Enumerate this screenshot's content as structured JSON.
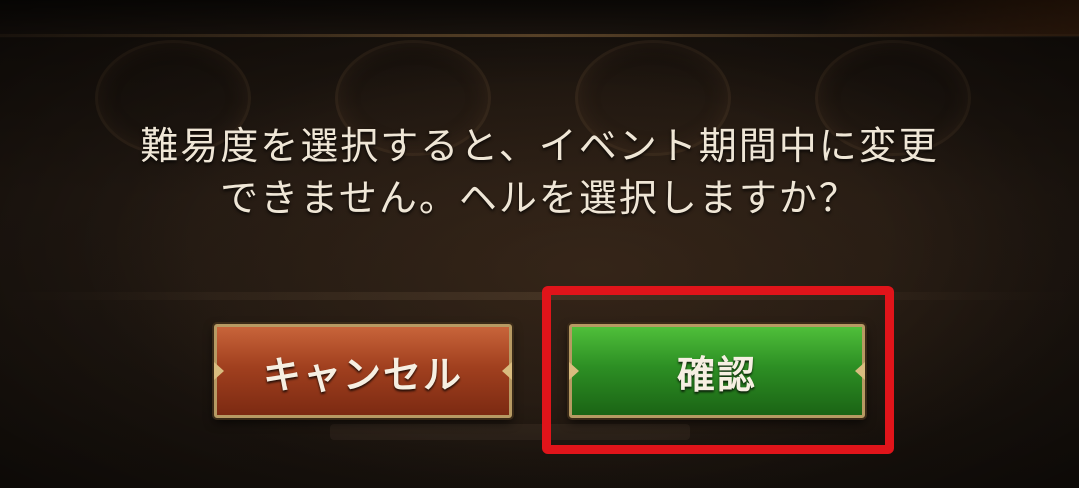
{
  "dialog": {
    "message_line1": "難易度を選択すると、イベント期間中に変更",
    "message_line2": "できません。ヘルを選択しますか？"
  },
  "buttons": {
    "cancel_label": "キャンセル",
    "confirm_label": "確認"
  },
  "colors": {
    "cancel_button": "#a1401f",
    "confirm_button": "#2d8f24",
    "highlight_box": "#e0141a",
    "text": "#efe6d6"
  }
}
